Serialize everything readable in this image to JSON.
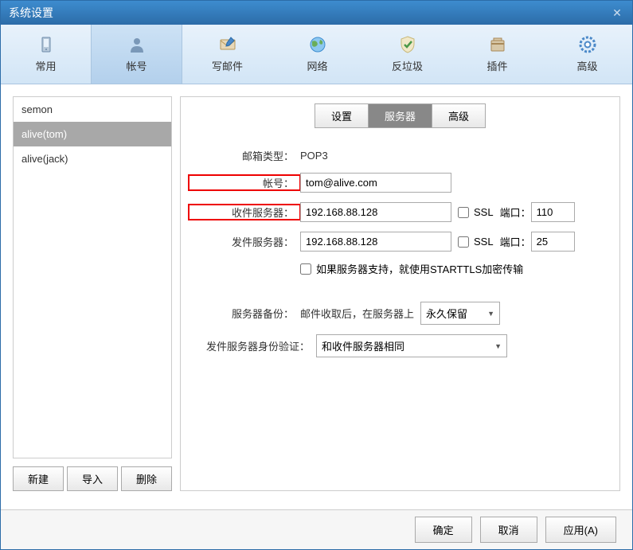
{
  "window": {
    "title": "系统设置"
  },
  "toolbar": {
    "items": [
      {
        "label": "常用",
        "icon": "phone-icon"
      },
      {
        "label": "帐号",
        "icon": "user-icon"
      },
      {
        "label": "写邮件",
        "icon": "compose-icon"
      },
      {
        "label": "网络",
        "icon": "globe-icon"
      },
      {
        "label": "反垃圾",
        "icon": "shield-icon"
      },
      {
        "label": "插件",
        "icon": "plugin-icon"
      },
      {
        "label": "高级",
        "icon": "gear-icon"
      }
    ]
  },
  "sidebar": {
    "accounts": [
      "semon",
      "alive(tom)",
      "alive(jack)"
    ],
    "buttons": {
      "new": "新建",
      "import": "导入",
      "delete": "删除"
    }
  },
  "tabs": {
    "settings": "设置",
    "server": "服务器",
    "advanced": "高级"
  },
  "form": {
    "mailbox_type_label": "邮箱类型：",
    "mailbox_type_value": "POP3",
    "account_label": "帐号：",
    "account_value": "tom@alive.com",
    "recv_server_label": "收件服务器：",
    "recv_server_value": "192.168.88.128",
    "recv_ssl_label": "SSL",
    "recv_port_label": "端口：",
    "recv_port_value": "110",
    "send_server_label": "发件服务器：",
    "send_server_value": "192.168.88.128",
    "send_ssl_label": "SSL",
    "send_port_label": "端口：",
    "send_port_value": "25",
    "starttls_label": "如果服务器支持，就使用STARTTLS加密传输",
    "backup_label": "服务器备份：",
    "backup_text": "邮件收取后，在服务器上",
    "backup_select": "永久保留",
    "auth_label": "发件服务器身份验证：",
    "auth_select": "和收件服务器相同"
  },
  "footer": {
    "ok": "确定",
    "cancel": "取消",
    "apply": "应用(A)"
  }
}
